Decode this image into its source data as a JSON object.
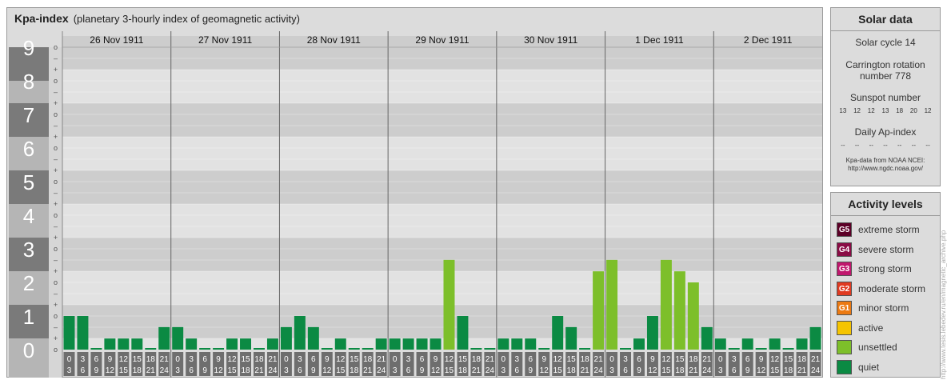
{
  "header": {
    "title": "Kpa-index",
    "subtitle": "(planetary 3-hourly index of geomagnetic activity)"
  },
  "chart_data": {
    "type": "bar",
    "title": "Kpa-index",
    "subtitle": "(planetary 3-hourly index of geomagnetic activity)",
    "ylim": [
      0,
      9
    ],
    "y_ticks": [
      "0",
      "1",
      "2",
      "3",
      "4",
      "5",
      "6",
      "7",
      "8",
      "9"
    ],
    "minor_tick_symbols": [
      "o",
      "+",
      "–"
    ],
    "days": [
      "26 Nov 1911",
      "27 Nov 1911",
      "28 Nov 1911",
      "29 Nov 1911",
      "30 Nov 1911",
      "1 Dec 1911",
      "2 Dec 1911"
    ],
    "interval_labels": [
      [
        "0",
        "3"
      ],
      [
        "3",
        "6"
      ],
      [
        "6",
        "9"
      ],
      [
        "9",
        "12"
      ],
      [
        "12",
        "15"
      ],
      [
        "15",
        "18"
      ],
      [
        "18",
        "21"
      ],
      [
        "21",
        "24"
      ]
    ],
    "values": [
      [
        1.0,
        1.0,
        0.0,
        0.33,
        0.33,
        0.33,
        0.0,
        0.67
      ],
      [
        0.67,
        0.33,
        0.0,
        0.0,
        0.33,
        0.33,
        0.0,
        0.33
      ],
      [
        0.67,
        1.0,
        0.67,
        0.0,
        0.33,
        0.0,
        0.0,
        0.33
      ],
      [
        0.33,
        0.33,
        0.33,
        0.33,
        2.67,
        1.0,
        0.0,
        0.0
      ],
      [
        0.33,
        0.33,
        0.33,
        0.0,
        1.0,
        0.67,
        0.0,
        2.33
      ],
      [
        2.67,
        0.0,
        0.33,
        1.0,
        2.67,
        2.33,
        2.0,
        0.67
      ],
      [
        0.33,
        0.0,
        0.33,
        0.0,
        0.33,
        0.0,
        0.33,
        0.67
      ]
    ],
    "colors": {
      "quiet": "#0b8a43",
      "unsettled": "#7dbf2a",
      "active": "#f5c400"
    }
  },
  "solar": {
    "heading": "Solar data",
    "cycle": "Solar cycle 14",
    "carrington_line1": "Carrington rotation",
    "carrington_line2": "number 778",
    "sunspot_heading": "Sunspot number",
    "sunspot_values": [
      "13",
      "12",
      "12",
      "13",
      "18",
      "20",
      "12"
    ],
    "ap_heading": "Daily Ap-index",
    "ap_values": [
      "--",
      "--",
      "--",
      "--",
      "--",
      "--",
      "--"
    ],
    "credit_line1": "Kpa-data from NOAA NCEI:",
    "credit_line2": "http://www.ngdc.noaa.gov/"
  },
  "activity": {
    "heading": "Activity levels",
    "levels": [
      {
        "badge": "G5",
        "label": "extreme storm",
        "color": "#5c0027"
      },
      {
        "badge": "G4",
        "label": "severe storm",
        "color": "#8a0c45"
      },
      {
        "badge": "G3",
        "label": "strong storm",
        "color": "#c0176d"
      },
      {
        "badge": "G2",
        "label": "moderate storm",
        "color": "#e03a21"
      },
      {
        "badge": "G1",
        "label": "minor storm",
        "color": "#ec7a12"
      },
      {
        "badge": "",
        "label": "active",
        "color": "#f5c400"
      },
      {
        "badge": "",
        "label": "unsettled",
        "color": "#7dbf2a"
      },
      {
        "badge": "",
        "label": "quiet",
        "color": "#0b8a43"
      }
    ]
  },
  "side_credit": "http://www.tesis.lebedev.ru/en/magnetic_archive.php"
}
